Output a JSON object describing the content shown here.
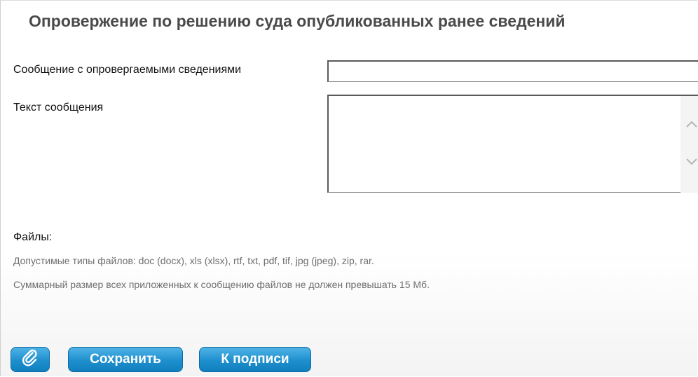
{
  "form": {
    "title": "Опровержение по решению суда опубликованных ранее сведений",
    "message_field_label": "Сообщение с опровергаемыми сведениями",
    "message_field_value": "",
    "text_field_label": "Текст сообщения",
    "text_field_value": ""
  },
  "files": {
    "title": "Файлы:",
    "allowed_types_note": "Допустимые типы файлов: doc (docx), xls (xlsx), rtf, txt, pdf, tif, jpg (jpeg), zip, rar.",
    "size_limit_note": "Суммарный размер всех приложенных к сообщению файлов не должен превышать 15 Мб."
  },
  "actions": {
    "attach_icon": "paperclip-icon",
    "save_label": "Сохранить",
    "sign_label": "К подписи"
  },
  "colors": {
    "button_primary": "#1e8fce",
    "title_text": "#4a4a4a",
    "note_text": "#6e6e6e"
  }
}
